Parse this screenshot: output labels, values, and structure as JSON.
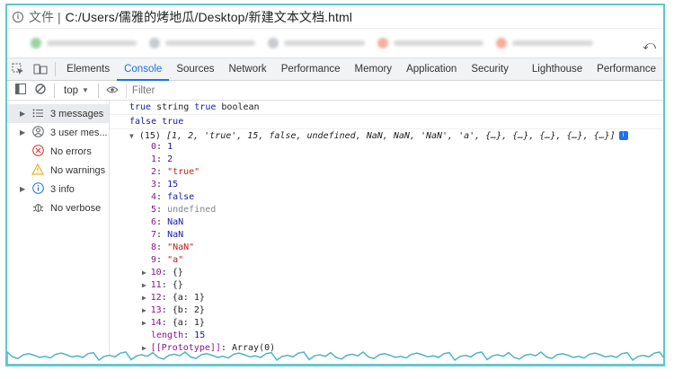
{
  "address_bar": {
    "info_label": "文件",
    "separator": "|",
    "url": "C:/Users/儒雅的烤地瓜/Desktop/新建文本文档.html"
  },
  "bookmarks": [
    {
      "color": "#4caf50",
      "width": 100
    },
    {
      "color": "#9aa0a6",
      "width": 100
    },
    {
      "color": "#9aa0a6",
      "width": 90
    },
    {
      "color": "#ef6c4f",
      "width": 100
    },
    {
      "color": "#ef6c4f",
      "width": 90
    }
  ],
  "devtools": {
    "tabs": [
      "Elements",
      "Console",
      "Sources",
      "Network",
      "Performance",
      "Memory",
      "Application",
      "Security",
      "Lighthouse",
      "Performance"
    ],
    "active_tab": "Console"
  },
  "console_toolbar": {
    "context": "top",
    "filter_placeholder": "Filter"
  },
  "sidebar": [
    {
      "label": "3 messages",
      "icon": "list-icon",
      "expandable": true,
      "selected": true
    },
    {
      "label": "3 user mes...",
      "icon": "user-icon",
      "expandable": true,
      "selected": false
    },
    {
      "label": "No errors",
      "icon": "error-icon",
      "expandable": false,
      "selected": false
    },
    {
      "label": "No warnings",
      "icon": "warning-icon",
      "expandable": false,
      "selected": false
    },
    {
      "label": "3 info",
      "icon": "info-icon",
      "expandable": true,
      "selected": false
    },
    {
      "label": "No verbose",
      "icon": "bug-icon",
      "expandable": false,
      "selected": false
    }
  ],
  "console": {
    "line1": [
      "true",
      "string",
      "true",
      "boolean"
    ],
    "line2": [
      "false",
      "true"
    ],
    "array_count": "(15)",
    "array_preview": "[1, 2, 'true', 15, false, undefined, NaN, NaN, 'NaN', 'a', {…}, {…}, {…}, {…}, {…}]",
    "items": [
      {
        "key": "0",
        "value": "1",
        "type": "num"
      },
      {
        "key": "1",
        "value": "2",
        "type": "num"
      },
      {
        "key": "2",
        "value": "\"true\"",
        "type": "str"
      },
      {
        "key": "3",
        "value": "15",
        "type": "num"
      },
      {
        "key": "4",
        "value": "false",
        "type": "bool"
      },
      {
        "key": "5",
        "value": "undefined",
        "type": "undef"
      },
      {
        "key": "6",
        "value": "NaN",
        "type": "num"
      },
      {
        "key": "7",
        "value": "NaN",
        "type": "num"
      },
      {
        "key": "8",
        "value": "\"NaN\"",
        "type": "str"
      },
      {
        "key": "9",
        "value": "\"a\"",
        "type": "str"
      },
      {
        "key": "10",
        "value": "{}",
        "type": "obj",
        "expandable": true
      },
      {
        "key": "11",
        "value": "{}",
        "type": "obj",
        "expandable": true
      },
      {
        "key": "12",
        "value": "{a: 1}",
        "type": "obj",
        "expandable": true
      },
      {
        "key": "13",
        "value": "{b: 2}",
        "type": "obj",
        "expandable": true
      },
      {
        "key": "14",
        "value": "{a: 1}",
        "type": "obj",
        "expandable": true
      },
      {
        "key": "length",
        "value": "15",
        "type": "num"
      },
      {
        "key": "[[Prototype]]",
        "value": "Array(0)",
        "type": "obj",
        "expandable": true
      }
    ]
  }
}
